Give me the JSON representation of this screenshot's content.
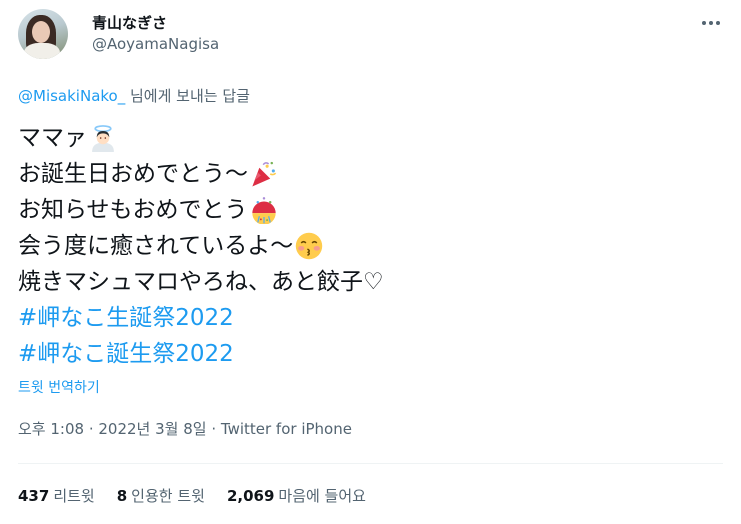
{
  "author": {
    "display_name": "青山なぎさ",
    "handle": "@AoyamaNagisa"
  },
  "reply": {
    "mention": "@MisakiNako_",
    "suffix": " 님에게 보내는 답글"
  },
  "tweet_lines": {
    "l1": "ママァ",
    "l2": "お誕生日おめでとう〜",
    "l3": "お知らせもおめでとう",
    "l4": "会う度に癒されているよ〜",
    "l5": "焼きマシュマロやろね、あと餃子♡",
    "h1": "#岬なこ生誕祭2022",
    "h2": "#岬なこ誕生祭2022"
  },
  "emojis": {
    "l1": "angel-emoji",
    "l2": "party-popper-emoji",
    "l3": "confetti-ball-emoji",
    "l4": "kissing-face-emoji"
  },
  "translate_label": "트윗 번역하기",
  "meta": {
    "time": "오후 1:08",
    "date": "2022년 3월 8일",
    "source": "Twitter for iPhone",
    "separator": " · "
  },
  "stats": {
    "retweets": {
      "count": "437",
      "label": "리트윗"
    },
    "quotes": {
      "count": "8",
      "label": "인용한 트윗"
    },
    "likes": {
      "count": "2,069",
      "label": "마음에 들어요"
    }
  },
  "colors": {
    "accent": "#1d9bf0",
    "secondary_text": "#536471",
    "primary_text": "#0f1419"
  }
}
